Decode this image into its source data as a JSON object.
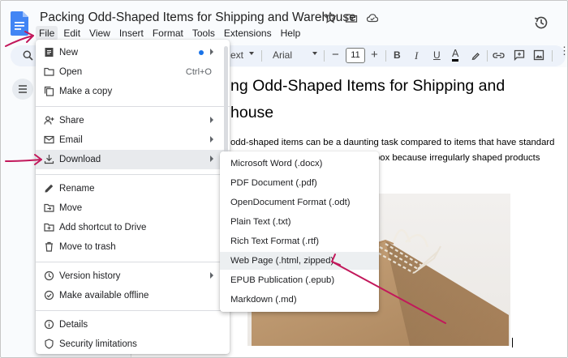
{
  "document": {
    "title": "Packing Odd-Shaped Items for Shipping and Warehouse",
    "heading_line1": "ng Odd-Shaped Items for Shipping and",
    "heading_line2": "house",
    "paragraph_line1": "odd-shaped items can be a daunting task compared to items that have standard",
    "paragraph_line2": "box because irregularly shaped products"
  },
  "menubar": [
    "File",
    "Edit",
    "View",
    "Insert",
    "Format",
    "Tools",
    "Extensions",
    "Help"
  ],
  "toolbar": {
    "style_partial": "ext",
    "font": "Arial",
    "font_size": "11",
    "minus": "−",
    "plus": "+",
    "bold": "B",
    "italic": "I",
    "underline": "U",
    "text_color": "A"
  },
  "file_menu": {
    "items": [
      {
        "label": "New",
        "icon": "new-doc-icon",
        "has_submenu": true,
        "indicator_dot": true
      },
      {
        "label": "Open",
        "icon": "folder-open-icon",
        "shortcut": "Ctrl+O"
      },
      {
        "label": "Make a copy",
        "icon": "copy-icon"
      },
      {
        "label": "Share",
        "icon": "share-person-icon",
        "has_submenu": true
      },
      {
        "label": "Email",
        "icon": "email-icon",
        "has_submenu": true
      },
      {
        "label": "Download",
        "icon": "download-icon",
        "has_submenu": true,
        "highlighted": true
      },
      {
        "label": "Rename",
        "icon": "pencil-icon"
      },
      {
        "label": "Move",
        "icon": "move-folder-icon"
      },
      {
        "label": "Add shortcut to Drive",
        "icon": "drive-shortcut-icon"
      },
      {
        "label": "Move to trash",
        "icon": "trash-icon"
      },
      {
        "label": "Version history",
        "icon": "history-icon",
        "has_submenu": true
      },
      {
        "label": "Make available offline",
        "icon": "offline-icon"
      },
      {
        "label": "Details",
        "icon": "info-icon"
      },
      {
        "label": "Security limitations",
        "icon": "shield-icon"
      }
    ]
  },
  "download_submenu": {
    "items": [
      {
        "label": "Microsoft Word (.docx)"
      },
      {
        "label": "PDF Document (.pdf)"
      },
      {
        "label": "OpenDocument Format (.odt)"
      },
      {
        "label": "Plain Text (.txt)"
      },
      {
        "label": "Rich Text Format (.rtf)"
      },
      {
        "label": "Web Page (.html, zipped)",
        "highlighted": true
      },
      {
        "label": "EPUB Publication (.epub)"
      },
      {
        "label": "Markdown (.md)"
      }
    ]
  },
  "colors": {
    "accent_blue": "#1a73e8",
    "annotation_arrow": "#c2185b",
    "toolbar_bg": "#edf2fa",
    "menu_highlight": "#e8eaed"
  }
}
